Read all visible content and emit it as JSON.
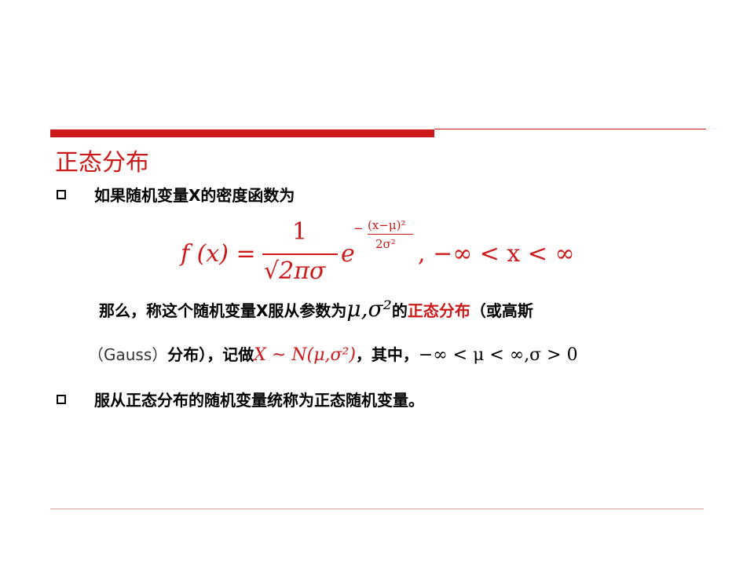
{
  "title": "正态分布",
  "bullets": [
    "如果随机变量X的密度函数为",
    "服从正态分布的随机变量统称为正态随机变量。"
  ],
  "formula": {
    "lhs": "f (x) =",
    "numerator": "1",
    "denominator": "√2πσ",
    "base": "e",
    "exp_sign": "−",
    "exp_numerator": "(x−μ)²",
    "exp_denominator": "2σ²",
    "range": ", −∞ < x < ∞"
  },
  "line3": {
    "prefix": "那么，称这个随机变量X服从参数为",
    "params": "μ,σ²",
    "mid": "的",
    "highlight": "正态分布",
    "suffix": "（或高斯"
  },
  "line4": {
    "gauss": "（Gauss）",
    "prefix": "分布），记做",
    "notation": "X ~ N(μ,σ²)",
    "mid": "，其中，",
    "condition": "−∞ < μ < ∞,σ > 0"
  },
  "colors": {
    "accent": "#cc1a1a"
  }
}
